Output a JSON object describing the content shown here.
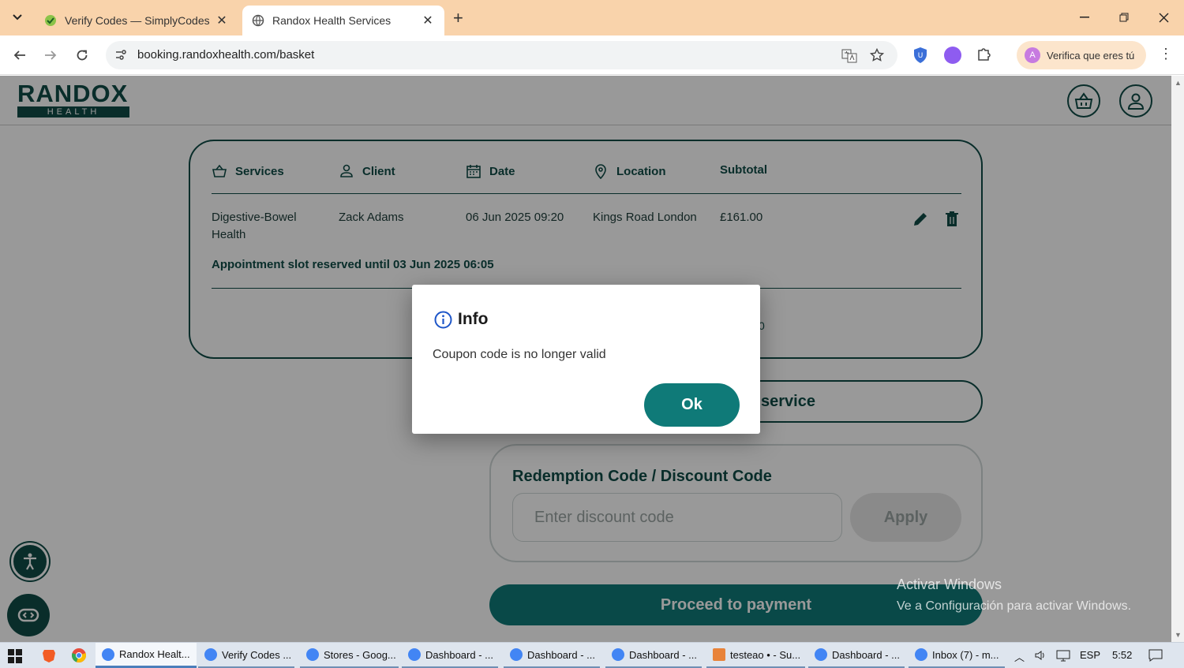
{
  "browser": {
    "tabs": [
      {
        "title": "Verify Codes — SimplyCodes",
        "active": false
      },
      {
        "title": "Randox Health Services",
        "active": true
      }
    ],
    "url": "booking.randoxhealth.com/basket",
    "profile_label": "Verifica que eres tú",
    "profile_initial": "A"
  },
  "header": {
    "logo_word": "RANDOX",
    "logo_sub": "HEALTH"
  },
  "basket": {
    "columns": [
      "Services",
      "Client",
      "Date",
      "Location",
      "Subtotal"
    ],
    "row": {
      "service": "Digestive-Bowel Health",
      "client": "Zack Adams",
      "date": "06 Jun 2025 09:20",
      "location": "Kings Road London",
      "subtotal": "£161.00"
    },
    "reserved_text": "Appointment slot reserved until 03 Jun 2025 06:05",
    "partial_text": "0"
  },
  "add_service_partial": "service",
  "redeem": {
    "title": "Redemption Code / Discount Code",
    "placeholder": "Enter discount code",
    "value": "",
    "apply_label": "Apply"
  },
  "proceed_label": "Proceed to payment",
  "watermark": {
    "line1": "Activar Windows",
    "line2": "Ve a Configuración para activar Windows."
  },
  "dialog": {
    "title": "Info",
    "message": "Coupon code is no longer valid",
    "ok_label": "Ok"
  },
  "taskbar": {
    "items": [
      {
        "label": "Randox Healt...",
        "active": true
      },
      {
        "label": "Verify Codes ...",
        "active": false
      },
      {
        "label": "Stores - Goog...",
        "active": false
      },
      {
        "label": "Dashboard - ...",
        "active": false
      },
      {
        "label": "Dashboard - ...",
        "active": false
      },
      {
        "label": "Dashboard - ...",
        "active": false
      },
      {
        "label": "testeao • - Su...",
        "active": false
      },
      {
        "label": "Dashboard - ...",
        "active": false
      },
      {
        "label": "Inbox (7) - m...",
        "active": false
      }
    ],
    "language": "ESP",
    "time": "5:52"
  },
  "colors": {
    "brand": "#0f4c47",
    "accent": "#0f7a78",
    "tabstrip": "#f9d3ab"
  }
}
